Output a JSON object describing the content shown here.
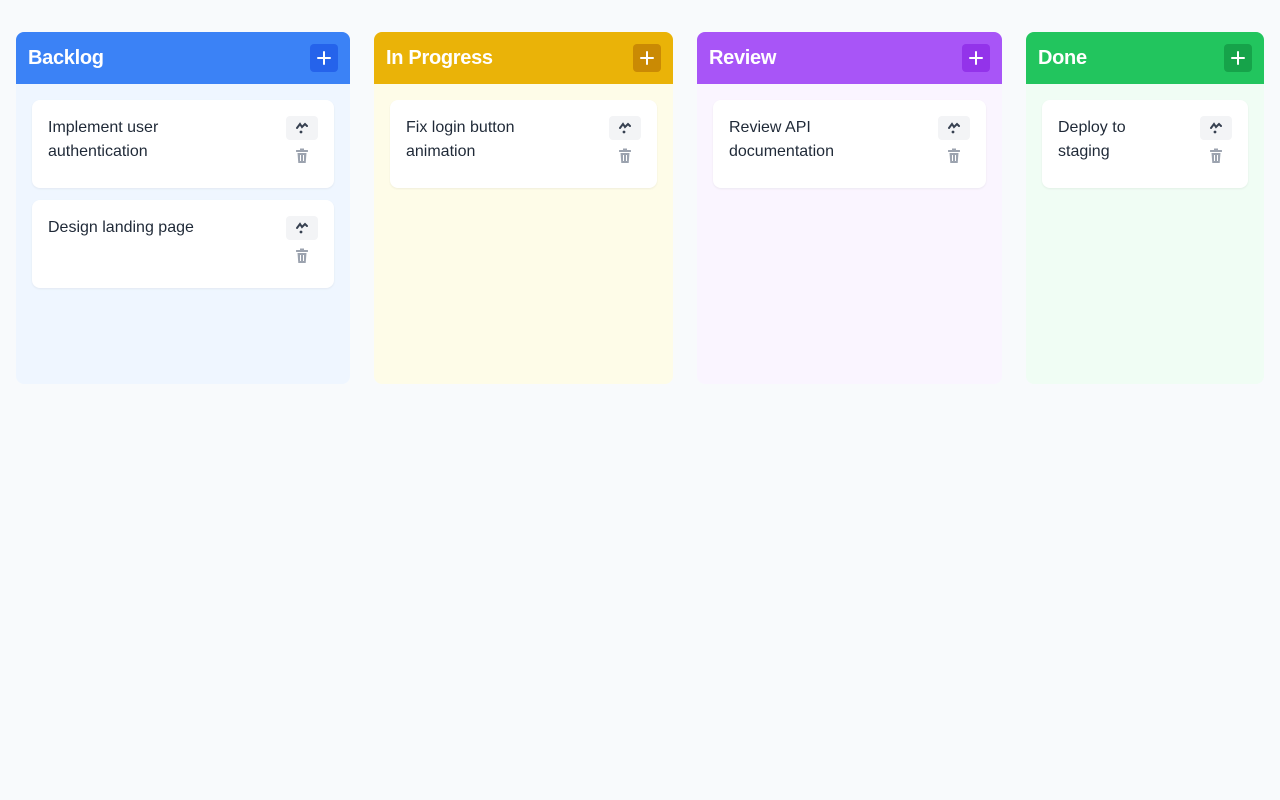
{
  "columns": [
    {
      "title": "Backlog",
      "header_color": "#3b82f6",
      "button_color": "#2563eb",
      "body_color": "#eff6ff",
      "add_icon": "plus-icon",
      "cards": [
        {
          "text": "Implement user authentication",
          "drag_icon": "drag-handle-icon",
          "delete_icon": "trash-icon"
        },
        {
          "text": "Design landing page",
          "drag_icon": "drag-handle-icon",
          "delete_icon": "trash-icon"
        }
      ]
    },
    {
      "title": "In Progress",
      "header_color": "#eab308",
      "button_color": "#ca8a04",
      "body_color": "#fefce8",
      "add_icon": "plus-icon",
      "cards": [
        {
          "text": "Fix login button animation",
          "drag_icon": "drag-handle-icon",
          "delete_icon": "trash-icon"
        }
      ]
    },
    {
      "title": "Review",
      "header_color": "#a855f7",
      "button_color": "#9333ea",
      "body_color": "#faf5ff",
      "add_icon": "plus-icon",
      "cards": [
        {
          "text": "Review API documentation",
          "drag_icon": "drag-handle-icon",
          "delete_icon": "trash-icon"
        }
      ]
    },
    {
      "title": "Done",
      "header_color": "#22c55e",
      "button_color": "#16a34a",
      "body_color": "#f0fdf4",
      "add_icon": "plus-icon",
      "cards": [
        {
          "text": "Deploy to staging",
          "drag_icon": "drag-handle-icon",
          "delete_icon": "trash-icon"
        }
      ]
    }
  ]
}
